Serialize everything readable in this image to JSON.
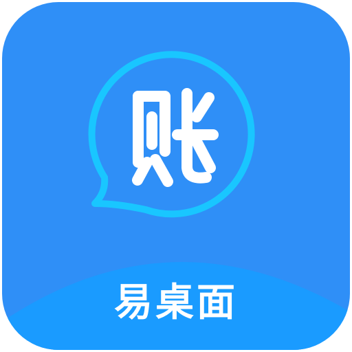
{
  "icon": {
    "logo_glyph": "账",
    "app_name": "易桌面",
    "colors": {
      "background": "#2f8ff7",
      "wave": "#1a9bff",
      "bubble_ring": "#19c6ff",
      "foreground": "#ffffff"
    }
  }
}
